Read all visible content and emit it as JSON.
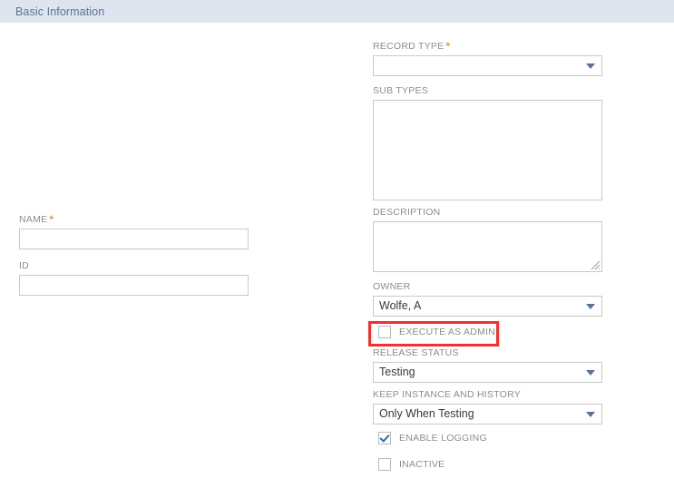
{
  "header": {
    "title": "Basic Information",
    "background_color": "#dfe5ee",
    "text_color": "#5b7394"
  },
  "theme": {
    "required_marker": "*",
    "required_color": "#e2a03c",
    "label_color": "#8d8d8d",
    "value_color": "#3a3a3a",
    "border_color": "#c9c9c9",
    "caret_color": "#5a7296",
    "checkmark_color": "#2c6fb5",
    "annotation_color": "#f42f2f",
    "page_background": "#ffffff"
  },
  "left_column": {
    "name_field": {
      "label": "NAME",
      "required": true,
      "value": "",
      "placeholder": ""
    },
    "id_field": {
      "label": "ID",
      "required": false,
      "value": "",
      "placeholder": ""
    }
  },
  "right_column": {
    "record_type": {
      "label": "RECORD TYPE",
      "required": true,
      "value": "",
      "icon": "chevron-down-icon"
    },
    "sub_types": {
      "label": "SUB TYPES",
      "value": ""
    },
    "description": {
      "label": "DESCRIPTION",
      "value": "",
      "placeholder": "",
      "icon": "resize-grip-icon"
    },
    "owner": {
      "label": "OWNER",
      "value": "Wolfe, A",
      "icon": "chevron-down-icon"
    },
    "execute_as_admin": {
      "label": "EXECUTE AS ADMIN",
      "checked": false,
      "highlighted": true
    },
    "release_status": {
      "label": "RELEASE STATUS",
      "value": "Testing",
      "icon": "chevron-down-icon"
    },
    "keep_instance_and_history": {
      "label": "KEEP INSTANCE AND HISTORY",
      "value": "Only When Testing",
      "icon": "chevron-down-icon"
    },
    "enable_logging": {
      "label": "ENABLE LOGGING",
      "checked": true
    },
    "inactive": {
      "label": "INACTIVE",
      "checked": false
    }
  }
}
